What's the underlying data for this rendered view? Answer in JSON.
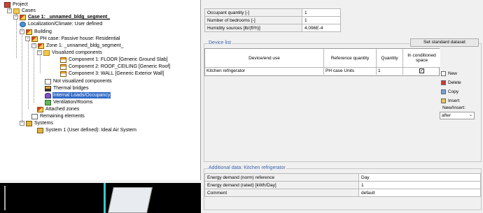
{
  "tree": {
    "project": "Project",
    "cases": "Cases",
    "case": "Case 1: _unnamed_bldg_segment_",
    "localization": "Localization/Climate: User defined",
    "building": "Building",
    "ph_case": "PH case: Passive house: Residential",
    "zone": "Zone 1: _unnamed_bldg_segment_",
    "visualized": "Visualized components",
    "comp1": "Component 1: FLOOR [Generic Ground Slab]",
    "comp2": "Component 2: ROOF_CEILING [Generic Roof]",
    "comp3": "Component 3: WALL [Generic Exterior Wall]",
    "not_visualized": "Not visualized components",
    "thermal": "Thermal bridges",
    "internal": "Internal Loads/Occupancy",
    "ventilation": "Ventilation/Rooms",
    "attached": "Attached zones",
    "remaining": "Remaining elements",
    "systems": "Systems",
    "system1": "System 1 (User defined): Ideal Air System"
  },
  "occupancy": [
    {
      "label": "Occupant quantity  [-]",
      "value": "1"
    },
    {
      "label": "Number of bedrooms [-]",
      "value": "1"
    },
    {
      "label": "Humidity sources  [lb/(ft²h)]",
      "value": "4.096E-4"
    }
  ],
  "device_list": {
    "title": "Device list",
    "std_button": "Set standard dataset",
    "headers": {
      "device": "Device/end use",
      "reference": "Reference quantity",
      "quantity": "Quantity",
      "conditioned": "In conditioned space"
    },
    "rows": [
      {
        "device": "Kitchen refrigerator",
        "reference": "PH case Units",
        "quantity": "1",
        "conditioned": "✓"
      }
    ]
  },
  "side_actions": {
    "new": "New",
    "delete": "Delete",
    "copy": "Copy",
    "insert": "Insert",
    "new_insert_label": "New/Insert:",
    "position": "after"
  },
  "additional": {
    "title": "Additional data: Kitchen refrigerator",
    "rows": [
      {
        "label": "Energy demand (norm) reference",
        "value": "Day"
      },
      {
        "label": "Energy demand (rated) [kWh/Day]",
        "value": "1"
      },
      {
        "label": "Comment",
        "value": "default"
      }
    ]
  }
}
